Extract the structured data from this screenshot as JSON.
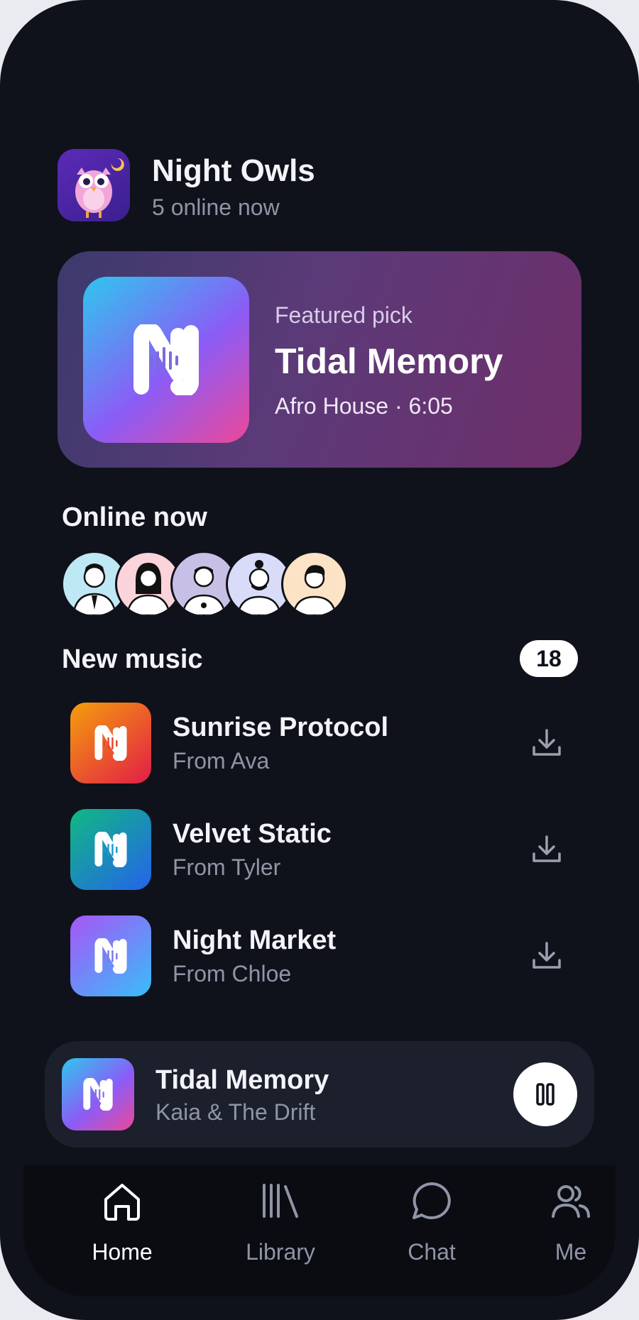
{
  "group": {
    "name": "Night Owls",
    "status": "5 online now",
    "avatar_icon": "owl-icon"
  },
  "featured": {
    "label": "Featured pick",
    "title": "Tidal Memory",
    "meta": "Afro House · 6:05",
    "art_icon": "n-waveform-logo-icon"
  },
  "online": {
    "title": "Online now",
    "users": [
      {
        "icon": "user-avatar-1",
        "bg": "#bfe8f5"
      },
      {
        "icon": "user-avatar-2",
        "bg": "#fbd3da"
      },
      {
        "icon": "user-avatar-3",
        "bg": "#c8bfe6"
      },
      {
        "icon": "user-avatar-4",
        "bg": "#d9dcf8"
      },
      {
        "icon": "user-avatar-5",
        "bg": "#fde3c6"
      }
    ]
  },
  "new_music": {
    "title": "New music",
    "count": "18",
    "tracks": [
      {
        "title": "Sunrise Protocol",
        "from": "From Ava",
        "colors": [
          "#f59e0b",
          "#e11d48"
        ]
      },
      {
        "title": "Velvet Static",
        "from": "From Tyler",
        "colors": [
          "#10b981",
          "#2563eb"
        ]
      },
      {
        "title": "Night Market",
        "from": "From Chloe",
        "colors": [
          "#a855f7",
          "#38bdf8"
        ]
      }
    ],
    "download_icon": "download-icon"
  },
  "player": {
    "title": "Tidal Memory",
    "artist": "Kaia & The Drift",
    "state_icon": "pause-icon"
  },
  "tabs": [
    {
      "label": "Home",
      "icon": "home-icon",
      "active": true
    },
    {
      "label": "Library",
      "icon": "library-icon",
      "active": false
    },
    {
      "label": "Chat",
      "icon": "chat-icon",
      "active": false
    },
    {
      "label": "Me",
      "icon": "people-icon",
      "active": false
    }
  ],
  "colors": {
    "background": "#0f121b",
    "text_primary": "#f3f4f8",
    "text_secondary": "#8f95a6",
    "tab_active": "#ffffff",
    "tab_inactive": "#8f95a6"
  }
}
